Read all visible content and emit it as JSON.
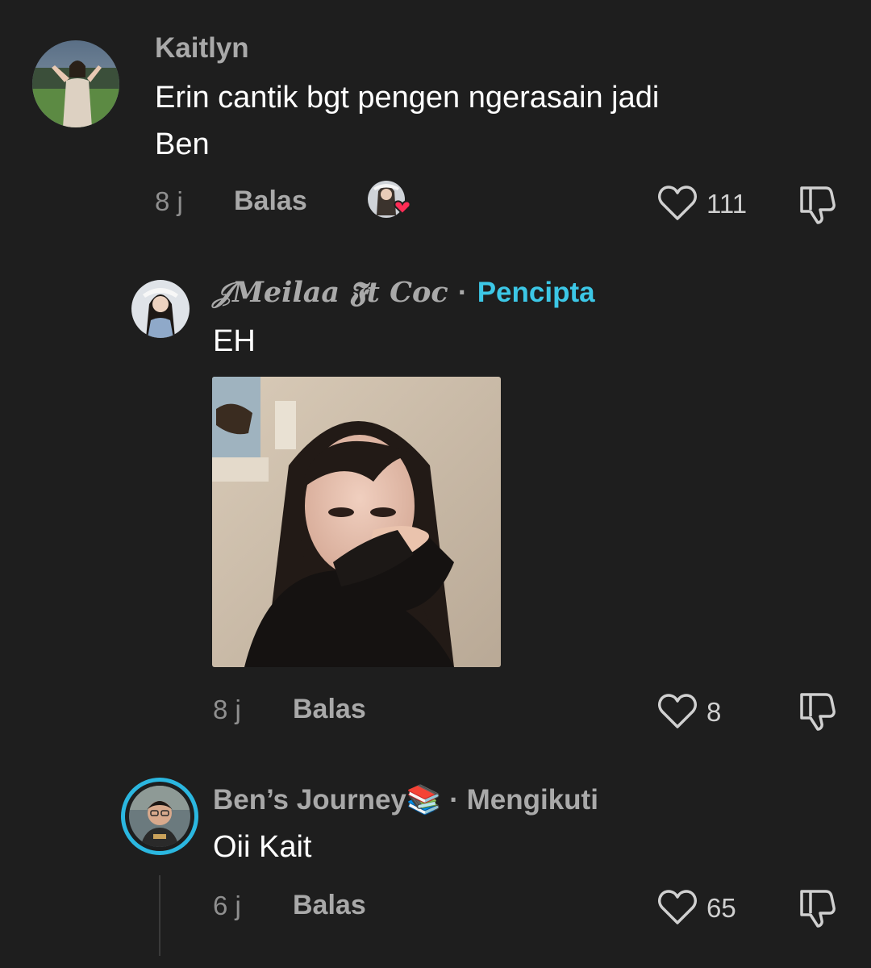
{
  "comment": {
    "username": "Kaitlyn",
    "text_line1": "Erin cantik bgt pengen ngerasain jadi",
    "text_line2": "Ben",
    "time": "8 j",
    "reply_label": "Balas",
    "likes": "111"
  },
  "replies": [
    {
      "username": "𝒥Meilaa 𝕱t Coc",
      "separator": "·",
      "badge": "Pencipta",
      "text": "EH",
      "time": "8 j",
      "reply_label": "Balas",
      "likes": "8"
    },
    {
      "username": "Ben’s Journey📚",
      "separator": "·",
      "badge": "Mengikuti",
      "text": "Oii Kait",
      "time": "6 j",
      "reply_label": "Balas",
      "likes": "65"
    }
  ],
  "colors": {
    "background": "#1e1e1e",
    "creator_badge": "#3cc7e6",
    "heart_badge": "#fe2c55",
    "story_ring": "#2bb7e0"
  },
  "icons": [
    "heart-outline-icon",
    "dislike-icon",
    "creator-liked-icon"
  ]
}
